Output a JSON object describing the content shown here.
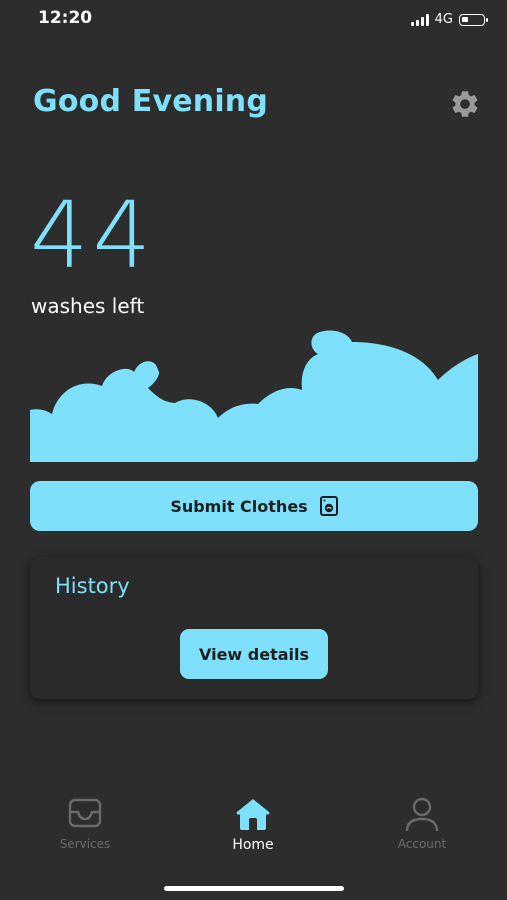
{
  "status_bar": {
    "time": "12:20",
    "network": "4G",
    "battery_level": 0.3
  },
  "header": {
    "greeting": "Good Evening",
    "settings_icon": "gear-icon"
  },
  "wash_counter": {
    "count": "44",
    "label": "washes left"
  },
  "submit": {
    "label": "Submit Clothes",
    "icon": "washing-machine-icon"
  },
  "history": {
    "title": "History",
    "button_label": "View details"
  },
  "tabs": [
    {
      "label": "Services",
      "icon": "tray-icon",
      "active": false
    },
    {
      "label": "Home",
      "icon": "home-icon",
      "active": true
    },
    {
      "label": "Account",
      "icon": "user-icon",
      "active": false
    }
  ],
  "colors": {
    "accent": "#7ee0fa",
    "background": "#2d2d2d",
    "card": "#2a2a2a",
    "inactive": "#6a6a6a"
  }
}
